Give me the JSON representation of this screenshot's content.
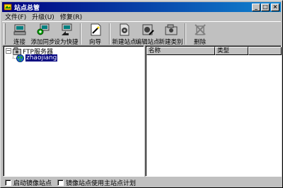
{
  "window": {
    "title": "站点总管",
    "minimize_glyph": "_",
    "maximize_glyph": "□",
    "close_glyph": "×"
  },
  "menu": [
    {
      "label": "文件(F)"
    },
    {
      "label": "升级(U)"
    },
    {
      "label": "修复(R)"
    }
  ],
  "toolbar": {
    "items": [
      {
        "label": "连接",
        "icon": "connect-icon"
      },
      {
        "label": "添加同步",
        "icon": "add-sync-icon"
      },
      {
        "label": "设为快捷",
        "icon": "shortcut-icon"
      },
      {
        "label": "向导",
        "icon": "wizard-icon"
      },
      {
        "label": "新建站点",
        "icon": "new-site-icon"
      },
      {
        "label": "编辑站点",
        "icon": "edit-site-icon"
      },
      {
        "label": "新建类别",
        "icon": "new-category-icon"
      },
      {
        "label": "删除",
        "icon": "delete-icon"
      }
    ]
  },
  "tree": {
    "root": {
      "expander": "−",
      "label": "FTP服务器"
    },
    "child": {
      "label": "zhaojiang",
      "selected": true
    }
  },
  "list": {
    "columns": [
      {
        "label": "名称"
      },
      {
        "label": "类型"
      }
    ]
  },
  "status": {
    "mirror_checkbox": {
      "label": "启动镜像站点",
      "checked": false
    },
    "mirror_plan_checkbox": {
      "label": "镜像站点使用主站点计划",
      "checked": false
    }
  },
  "colors": {
    "title_start": "#000080",
    "title_end": "#1084d0",
    "selection": "#000080",
    "face": "#c0c0c0"
  }
}
